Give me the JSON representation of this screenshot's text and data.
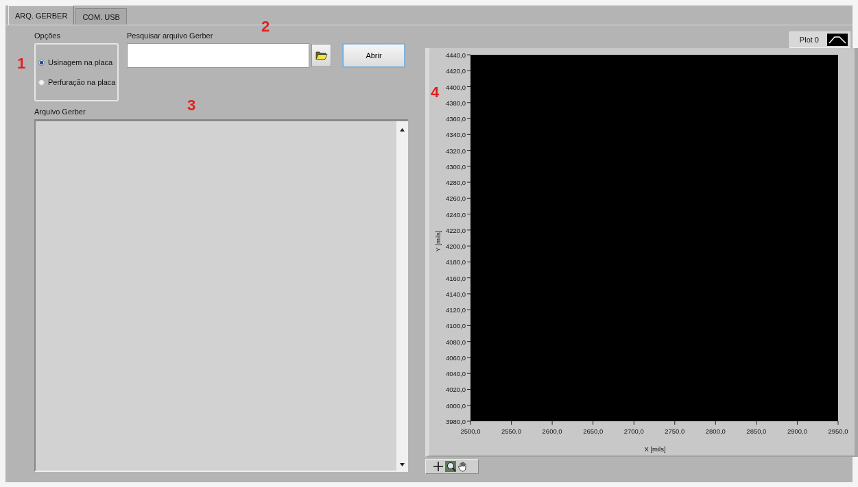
{
  "tabs": [
    {
      "label": "ARQ. GERBER",
      "selected": true
    },
    {
      "label": "COM. USB",
      "selected": false
    }
  ],
  "options": {
    "label": "Opções",
    "items": [
      {
        "label": "Usinagem na placa",
        "selected": true
      },
      {
        "label": "Perfuração na placa",
        "selected": false
      }
    ]
  },
  "search": {
    "label": "Pesquisar arquivo Gerber"
  },
  "open_button": "Abrir",
  "text_area": {
    "label": "Arquivo Gerber"
  },
  "annotations": [
    "1",
    "2",
    "3",
    "4"
  ],
  "graph": {
    "legend": "Plot 0",
    "chart_data": {
      "type": "line",
      "xlabel": "X [mils]",
      "ylabel": "Y [mils]",
      "xlim": [
        2500,
        2950
      ],
      "ylim": [
        3980,
        4440
      ],
      "xticks": [
        {
          "value": 2500,
          "label": "2500,0"
        },
        {
          "value": 2550,
          "label": "2550,0"
        },
        {
          "value": 2600,
          "label": "2600,0"
        },
        {
          "value": 2650,
          "label": "2650,0"
        },
        {
          "value": 2700,
          "label": "2700,0"
        },
        {
          "value": 2750,
          "label": "2750,0"
        },
        {
          "value": 2800,
          "label": "2800,0"
        },
        {
          "value": 2850,
          "label": "2850,0"
        },
        {
          "value": 2900,
          "label": "2900,0"
        },
        {
          "value": 2950,
          "label": "2950,0"
        }
      ],
      "yticks": [
        {
          "value": 4440,
          "label": "4440,0"
        },
        {
          "value": 4420,
          "label": "4420,0"
        },
        {
          "value": 4400,
          "label": "4400,0"
        },
        {
          "value": 4380,
          "label": "4380,0"
        },
        {
          "value": 4360,
          "label": "4360,0"
        },
        {
          "value": 4340,
          "label": "4340,0"
        },
        {
          "value": 4320,
          "label": "4320,0"
        },
        {
          "value": 4300,
          "label": "4300,0"
        },
        {
          "value": 4280,
          "label": "4280,0"
        },
        {
          "value": 4260,
          "label": "4260,0"
        },
        {
          "value": 4240,
          "label": "4240,0"
        },
        {
          "value": 4220,
          "label": "4220,0"
        },
        {
          "value": 4200,
          "label": "4200,0"
        },
        {
          "value": 4180,
          "label": "4180,0"
        },
        {
          "value": 4160,
          "label": "4160,0"
        },
        {
          "value": 4140,
          "label": "4140,0"
        },
        {
          "value": 4120,
          "label": "4120,0"
        },
        {
          "value": 4100,
          "label": "4100,0"
        },
        {
          "value": 4080,
          "label": "4080,0"
        },
        {
          "value": 4060,
          "label": "4060,0"
        },
        {
          "value": 4040,
          "label": "4040,0"
        },
        {
          "value": 4020,
          "label": "4020,0"
        },
        {
          "value": 4000,
          "label": "4000,0"
        },
        {
          "value": 3980,
          "label": "3980,0"
        }
      ]
    }
  }
}
